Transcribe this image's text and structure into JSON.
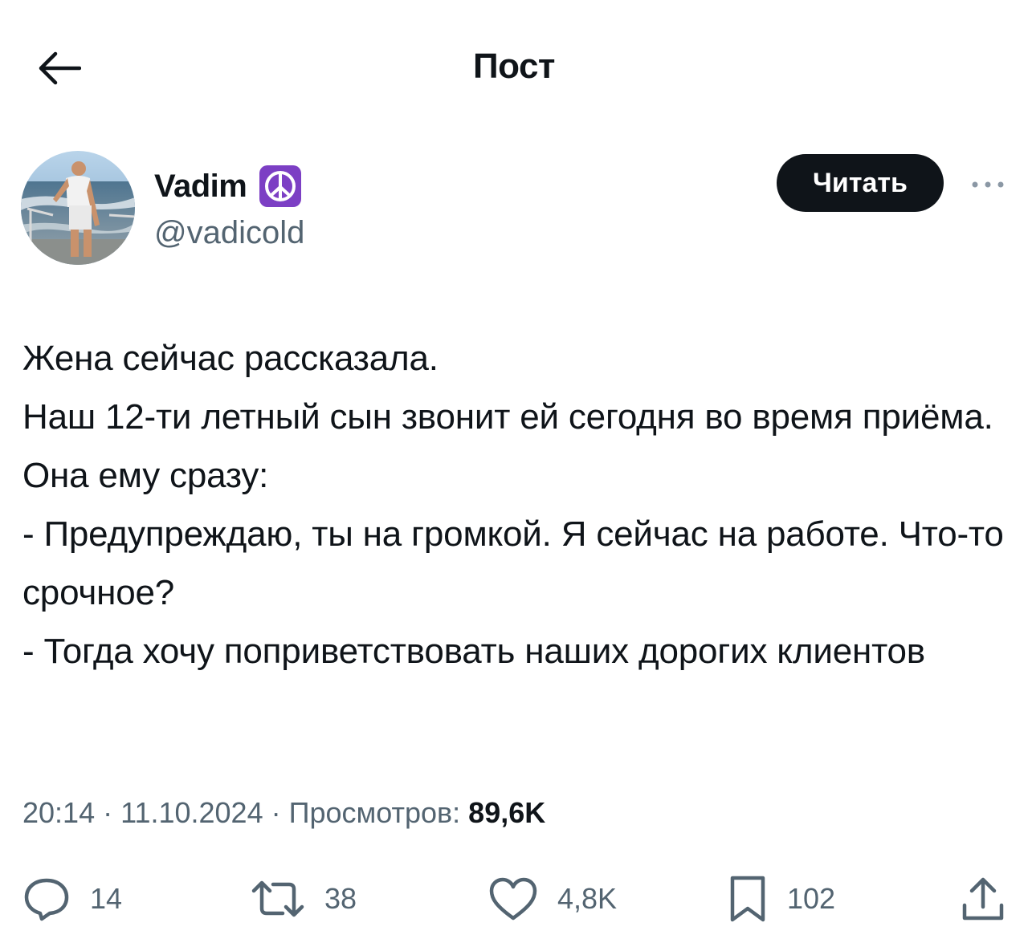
{
  "header": {
    "title": "Пост"
  },
  "author": {
    "name": "Vadim",
    "handle": "@vadicold",
    "badge_icon": "peace-symbol-icon",
    "follow_label": "Читать"
  },
  "post": {
    "text": "Жена сейчас рассказала.\nНаш 12-ти летный сын звонит ей сегодня во время приёма. Она ему сразу:\n- Предупреждаю, ты на громкой. Я сейчас на работе. Что-то срочное?\n- Тогда хочу поприветствовать наших дорогих клиентов"
  },
  "meta": {
    "time": "20:14",
    "separator": " · ",
    "date": "11.10.2024",
    "views_label": "Просмотров: ",
    "views_count": "89,6K"
  },
  "actions": {
    "replies": "14",
    "reposts": "38",
    "likes": "4,8K",
    "bookmarks": "102"
  },
  "colors": {
    "text": "#0f1419",
    "secondary": "#536471",
    "badge": "#7c3fc4",
    "button_bg": "#0f1419"
  }
}
